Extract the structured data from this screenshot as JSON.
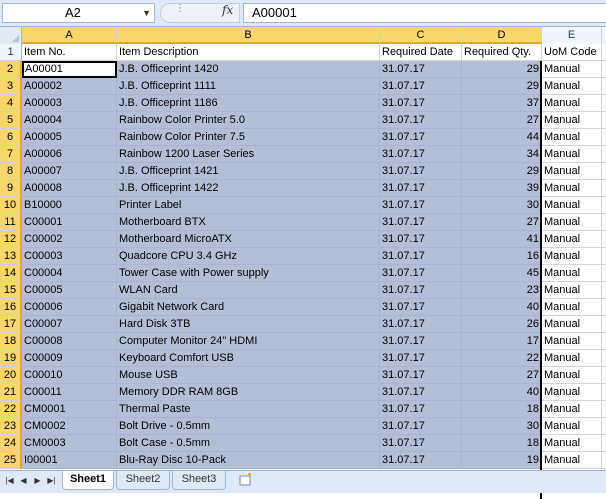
{
  "formula_bar": {
    "name_box": "A2",
    "fx_label": "fx",
    "formula": "A00001"
  },
  "columns": [
    {
      "letter": "A"
    },
    {
      "letter": "B"
    },
    {
      "letter": "C"
    },
    {
      "letter": "D"
    },
    {
      "letter": "E"
    },
    {
      "letter": ""
    }
  ],
  "header_row": {
    "row_number": "1",
    "cells": [
      "Item No.",
      "Item Description",
      "Required Date",
      "Required Qty.",
      "UoM Code",
      ""
    ]
  },
  "rows": [
    {
      "n": "2",
      "item": "A00001",
      "desc": "J.B. Officeprint 1420",
      "date": "31.07.17",
      "qty": "29",
      "uom": "Manual"
    },
    {
      "n": "3",
      "item": "A00002",
      "desc": "J.B. Officeprint 1111",
      "date": "31.07.17",
      "qty": "29",
      "uom": "Manual"
    },
    {
      "n": "4",
      "item": "A00003",
      "desc": "J.B. Officeprint 1186",
      "date": "31.07.17",
      "qty": "37",
      "uom": "Manual"
    },
    {
      "n": "5",
      "item": "A00004",
      "desc": "Rainbow Color Printer 5.0",
      "date": "31.07.17",
      "qty": "27",
      "uom": "Manual"
    },
    {
      "n": "6",
      "item": "A00005",
      "desc": "Rainbow Color Printer 7.5",
      "date": "31.07.17",
      "qty": "44",
      "uom": "Manual"
    },
    {
      "n": "7",
      "item": "A00006",
      "desc": "Rainbow 1200 Laser Series",
      "date": "31.07.17",
      "qty": "34",
      "uom": "Manual"
    },
    {
      "n": "8",
      "item": "A00007",
      "desc": "J.B. Officeprint 1421",
      "date": "31.07.17",
      "qty": "29",
      "uom": "Manual"
    },
    {
      "n": "9",
      "item": "A00008",
      "desc": "J.B. Officeprint 1422",
      "date": "31.07.17",
      "qty": "39",
      "uom": "Manual"
    },
    {
      "n": "10",
      "item": "B10000",
      "desc": "Printer Label",
      "date": "31.07.17",
      "qty": "30",
      "uom": "Manual"
    },
    {
      "n": "11",
      "item": "C00001",
      "desc": "Motherboard BTX",
      "date": "31.07.17",
      "qty": "27",
      "uom": "Manual"
    },
    {
      "n": "12",
      "item": "C00002",
      "desc": "Motherboard MicroATX",
      "date": "31.07.17",
      "qty": "41",
      "uom": "Manual"
    },
    {
      "n": "13",
      "item": "C00003",
      "desc": "Quadcore CPU 3.4 GHz",
      "date": "31.07.17",
      "qty": "16",
      "uom": "Manual"
    },
    {
      "n": "14",
      "item": "C00004",
      "desc": "Tower Case with Power supply",
      "date": "31.07.17",
      "qty": "45",
      "uom": "Manual"
    },
    {
      "n": "15",
      "item": "C00005",
      "desc": "WLAN Card",
      "date": "31.07.17",
      "qty": "23",
      "uom": "Manual"
    },
    {
      "n": "16",
      "item": "C00006",
      "desc": "Gigabit Network Card",
      "date": "31.07.17",
      "qty": "40",
      "uom": "Manual"
    },
    {
      "n": "17",
      "item": "C00007",
      "desc": "Hard Disk 3TB",
      "date": "31.07.17",
      "qty": "26",
      "uom": "Manual"
    },
    {
      "n": "18",
      "item": "C00008",
      "desc": "Computer Monitor 24\" HDMI",
      "date": "31.07.17",
      "qty": "17",
      "uom": "Manual"
    },
    {
      "n": "19",
      "item": "C00009",
      "desc": "Keyboard Comfort USB",
      "date": "31.07.17",
      "qty": "22",
      "uom": "Manual"
    },
    {
      "n": "20",
      "item": "C00010",
      "desc": "Mouse USB",
      "date": "31.07.17",
      "qty": "27",
      "uom": "Manual"
    },
    {
      "n": "21",
      "item": "C00011",
      "desc": "Memory DDR RAM 8GB",
      "date": "31.07.17",
      "qty": "40",
      "uom": "Manual"
    },
    {
      "n": "22",
      "item": "CM0001",
      "desc": "Thermal Paste",
      "date": "31.07.17",
      "qty": "18",
      "uom": "Manual"
    },
    {
      "n": "23",
      "item": "CM0002",
      "desc": "Bolt Drive - 0.5mm",
      "date": "31.07.17",
      "qty": "30",
      "uom": "Manual"
    },
    {
      "n": "24",
      "item": "CM0003",
      "desc": "Bolt Case - 0.5mm",
      "date": "31.07.17",
      "qty": "18",
      "uom": "Manual"
    },
    {
      "n": "25",
      "item": "I00001",
      "desc": "Blu-Ray Disc 10-Pack",
      "date": "31.07.17",
      "qty": "19",
      "uom": "Manual"
    }
  ],
  "sheet_tabs": [
    "Sheet1",
    "Sheet2",
    "Sheet3"
  ],
  "colors": {
    "selection": "#b4bfd6",
    "header_selected": "#f8d66a",
    "chrome": "#dfe8f5"
  }
}
